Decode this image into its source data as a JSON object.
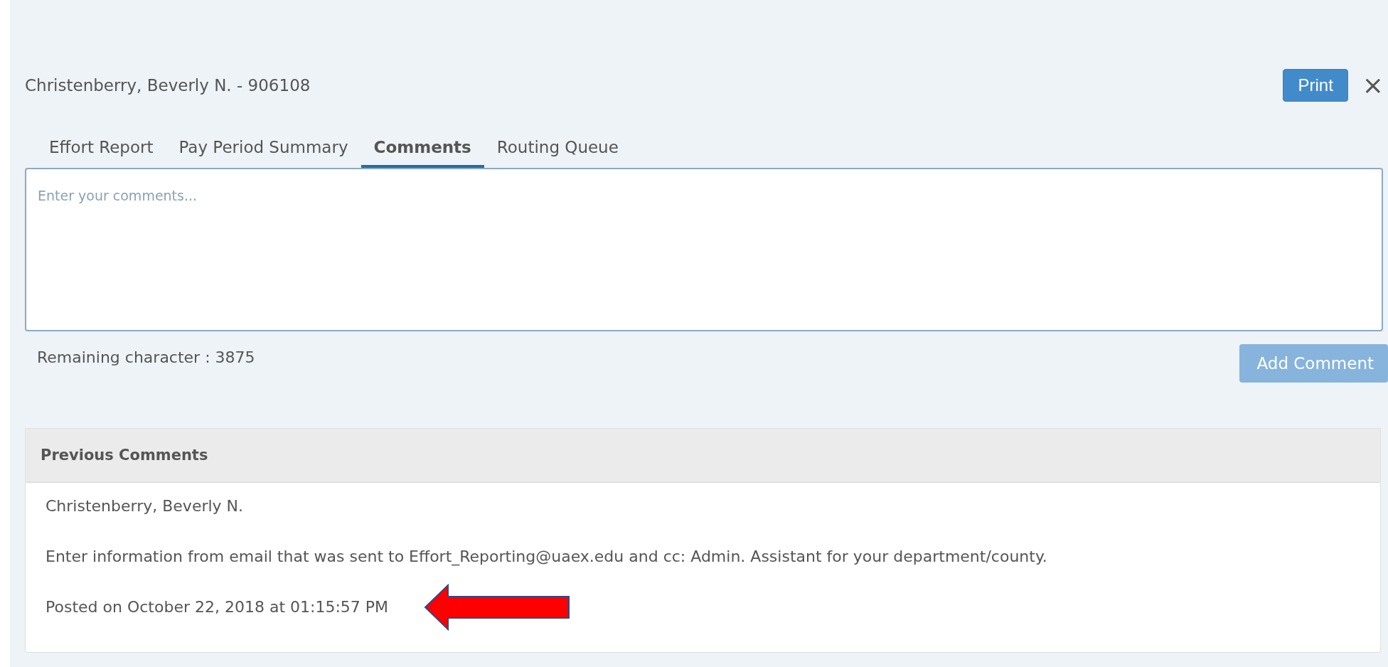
{
  "header": {
    "title": "Christenberry, Beverly N. - 906108",
    "print_button": "Print",
    "close_icon": "×"
  },
  "tabs": [
    {
      "label": "Effort Report",
      "selected": false
    },
    {
      "label": "Pay Period Summary",
      "selected": false
    },
    {
      "label": "Comments",
      "selected": true
    },
    {
      "label": "Routing Queue",
      "selected": false
    }
  ],
  "comment_box": {
    "placeholder": "Enter your comments...",
    "remaining": "Remaining character : 3875",
    "add_button": "Add Comment",
    "add_disabled": true
  },
  "previous_comments": {
    "title": "Previous Comments",
    "items": [
      {
        "author": "Christenberry, Beverly N.",
        "text": "Enter information from email that was sent to Effort_Reporting@uaex.edu and cc: Admin. Assistant for your department/county.",
        "posted": "Posted on October 22, 2018 at 01:15:57 PM"
      }
    ]
  }
}
